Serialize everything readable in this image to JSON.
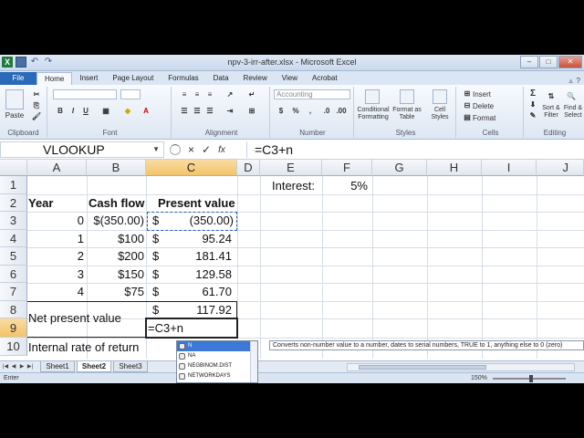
{
  "window": {
    "title": "npv-3-irr-after.xlsx - Microsoft Excel",
    "app_icon": "excel-icon"
  },
  "ribbon_tabs": [
    "File",
    "Home",
    "Insert",
    "Page Layout",
    "Formulas",
    "Data",
    "Review",
    "View",
    "Acrobat"
  ],
  "ribbon": {
    "clipboard": {
      "paste": "Paste",
      "label": "Clipboard"
    },
    "font": {
      "label": "Font",
      "bold": "B",
      "italic": "I",
      "underline": "U"
    },
    "alignment": {
      "label": "Alignment"
    },
    "number": {
      "format": "Accounting",
      "label": "Number",
      "currency": "$",
      "percent": "%",
      "comma": ","
    },
    "styles": {
      "conditional": "Conditional Formatting",
      "format_table": "Format as Table",
      "cell_styles": "Cell Styles",
      "label": "Styles"
    },
    "cells": {
      "insert": "Insert",
      "delete": "Delete",
      "format": "Format",
      "label": "Cells"
    },
    "editing": {
      "sort": "Sort & Filter",
      "find": "Find & Select",
      "label": "Editing"
    }
  },
  "formula_bar": {
    "name_box": "VLOOKUP",
    "cancel": "×",
    "enter": "✓",
    "fx": "fx",
    "formula": "=C3+n"
  },
  "columns": [
    "A",
    "B",
    "C",
    "D",
    "E",
    "F",
    "G",
    "H",
    "I",
    "J"
  ],
  "rows": [
    "1",
    "2",
    "3",
    "4",
    "5",
    "6",
    "7",
    "8",
    "9",
    "10"
  ],
  "cells": {
    "E1": "Interest:",
    "F1": "5%",
    "A2": "Year",
    "B2": "Cash flow",
    "C2": "Present value",
    "A3": "0",
    "B3": "$(350.00)",
    "C3_sym": "$",
    "C3": "(350.00)",
    "A4": "1",
    "B4": "$100",
    "C4_sym": "$",
    "C4": "95.24",
    "A5": "2",
    "B5": "$200",
    "C5_sym": "$",
    "C5": "181.41",
    "A6": "3",
    "B6": "$150",
    "C6_sym": "$",
    "C6": "129.58",
    "A7": "4",
    "B7": "$75",
    "C7_sym": "$",
    "C7": "61.70",
    "A8": "Net present value",
    "C8_sym": "$",
    "C8": "117.92",
    "C9": "=C3+n",
    "A10": "Internal rate of return"
  },
  "autocomplete": {
    "items": [
      "N",
      "NA",
      "NEGBINOM.DIST",
      "NETWORKDAYS"
    ],
    "tooltip": "Converts non-number value to a number, dates to serial numbers, TRUE to 1, anything else to 0 (zero)"
  },
  "sheets": [
    "Sheet1",
    "Sheet2",
    "Sheet3"
  ],
  "status": {
    "mode": "Enter",
    "zoom": "150%"
  }
}
